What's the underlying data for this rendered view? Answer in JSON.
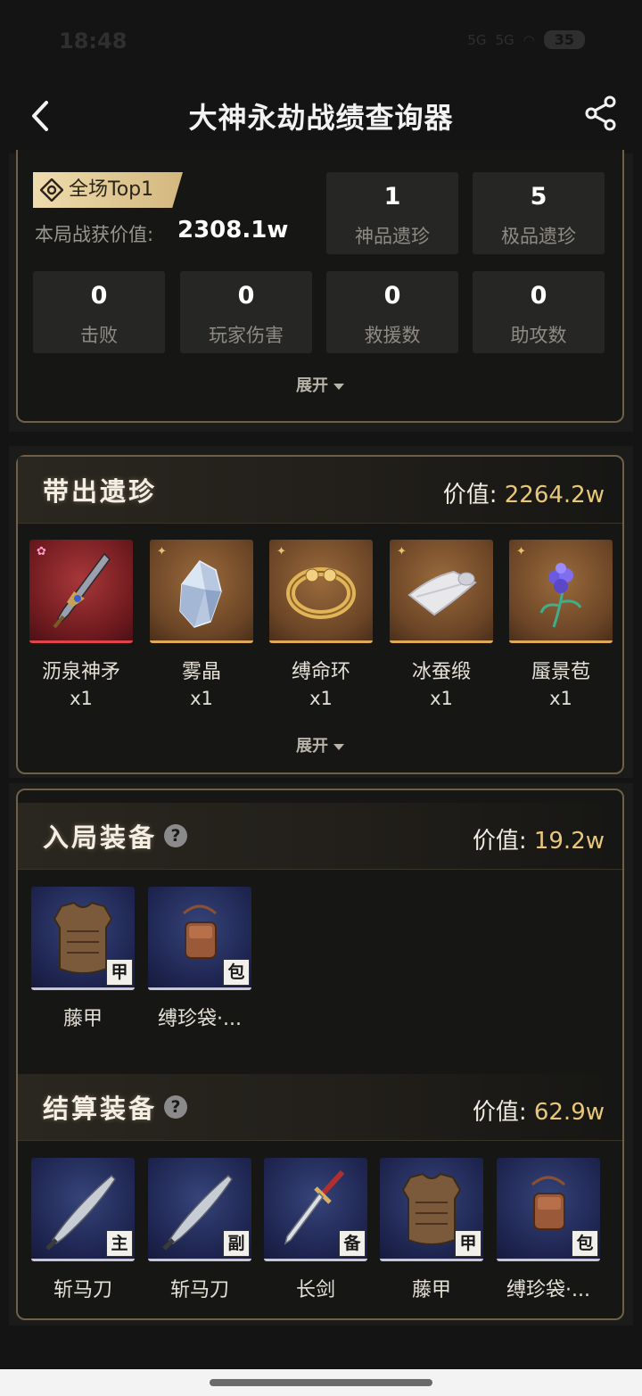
{
  "status": {
    "time": "18:48",
    "signal1": "5G",
    "signal2": "5G",
    "battery": "35"
  },
  "nav": {
    "title": "大神永劫战绩查询器"
  },
  "summary": {
    "badge": "全场Top1",
    "loot_label": "本局战获价值:",
    "loot_value": "2308.1w",
    "stats": [
      {
        "value": "1",
        "label": "神品遗珍"
      },
      {
        "value": "5",
        "label": "极品遗珍"
      },
      {
        "value": "0",
        "label": "击败"
      },
      {
        "value": "0",
        "label": "玩家伤害"
      },
      {
        "value": "0",
        "label": "救援数"
      },
      {
        "value": "0",
        "label": "助攻数"
      }
    ],
    "expand": "展开"
  },
  "relics": {
    "title": "带出遗珍",
    "value_label": "价值:",
    "value": "2264.2w",
    "expand": "展开",
    "items": [
      {
        "name": "沥泉神矛",
        "qty": "x1",
        "icon": "spear-icon",
        "rarity": "red"
      },
      {
        "name": "雾晶",
        "qty": "x1",
        "icon": "crystal-icon",
        "rarity": "gold"
      },
      {
        "name": "缚命环",
        "qty": "x1",
        "icon": "ring-icon",
        "rarity": "gold"
      },
      {
        "name": "冰蚕缎",
        "qty": "x1",
        "icon": "silk-icon",
        "rarity": "gold"
      },
      {
        "name": "蜃景苞",
        "qty": "x1",
        "icon": "flower-icon",
        "rarity": "gold"
      }
    ]
  },
  "entry_gear": {
    "title": "入局装备",
    "value_label": "价值:",
    "value": "19.2w",
    "items": [
      {
        "name": "藤甲",
        "tag": "甲",
        "icon": "armor-icon"
      },
      {
        "name": "缚珍袋·...",
        "tag": "包",
        "icon": "bag-icon"
      }
    ]
  },
  "final_gear": {
    "title": "结算装备",
    "value_label": "价值:",
    "value": "62.9w",
    "items": [
      {
        "name": "斩马刀",
        "tag": "主",
        "icon": "blade-icon"
      },
      {
        "name": "斩马刀",
        "tag": "副",
        "icon": "blade-icon"
      },
      {
        "name": "长剑",
        "tag": "备",
        "icon": "sword-icon"
      },
      {
        "name": "藤甲",
        "tag": "甲",
        "icon": "armor-icon"
      },
      {
        "name": "缚珍袋·...",
        "tag": "包",
        "icon": "bag-icon"
      }
    ]
  }
}
